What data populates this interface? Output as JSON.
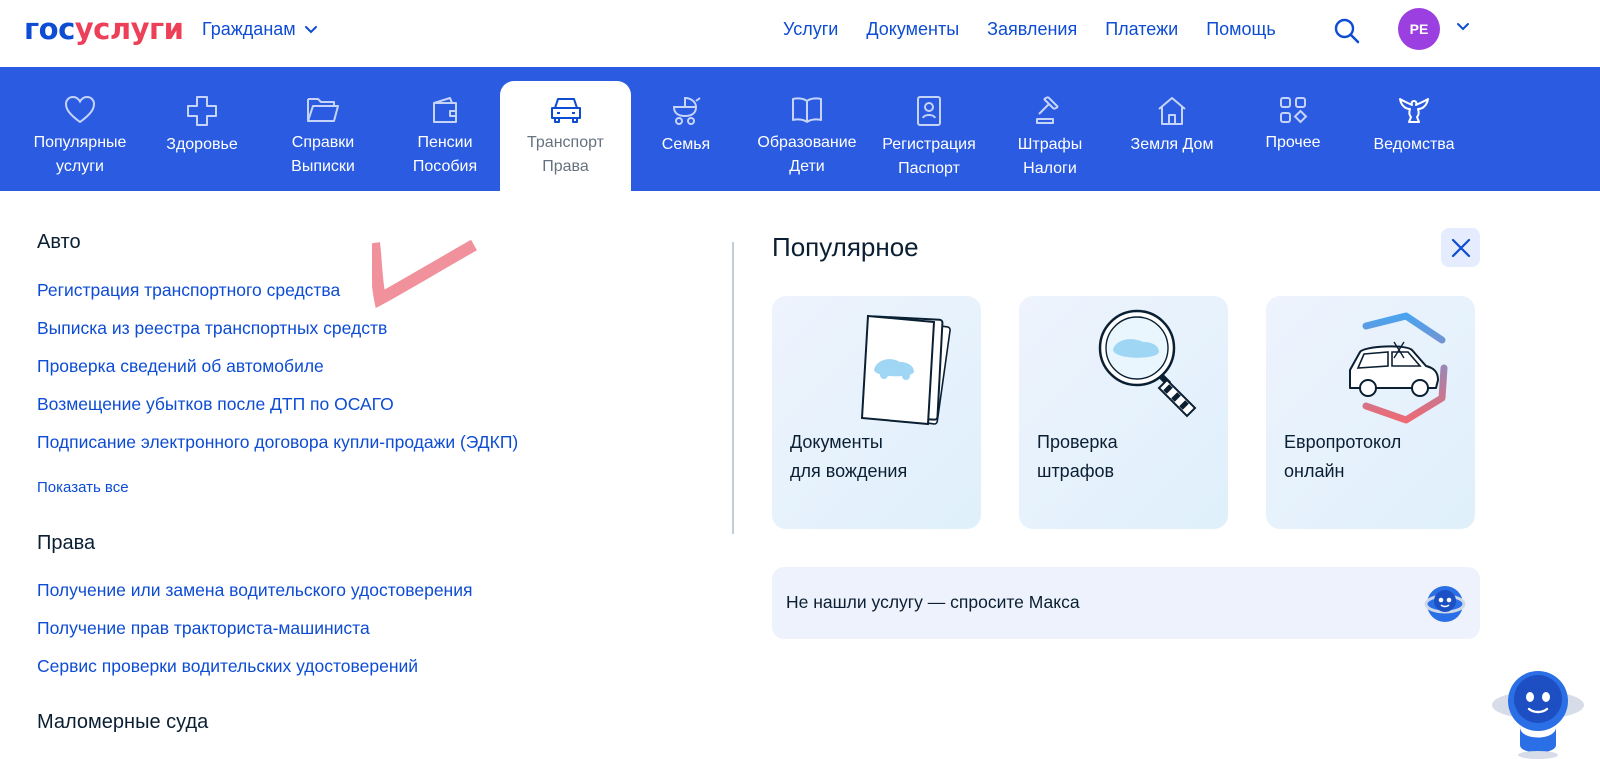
{
  "header": {
    "logo_part1": "гос",
    "logo_part2": "услуги",
    "audience": "Гражданам",
    "nav": [
      "Услуги",
      "Документы",
      "Заявления",
      "Платежи",
      "Помощь"
    ],
    "avatar_initials": "РЕ"
  },
  "categories": [
    {
      "line1": "Популярные",
      "line2": "услуги",
      "icon": "heart-icon"
    },
    {
      "line1": "Здоровье",
      "line2": "",
      "icon": "medical-cross-icon"
    },
    {
      "line1": "Справки",
      "line2": "Выписки",
      "icon": "folder-icon"
    },
    {
      "line1": "Пенсии",
      "line2": "Пособия",
      "icon": "wallet-icon"
    },
    {
      "line1": "Транспорт",
      "line2": "Права",
      "icon": "car-icon",
      "active": true
    },
    {
      "line1": "Семья",
      "line2": "",
      "icon": "stroller-icon"
    },
    {
      "line1": "Образование",
      "line2": "Дети",
      "icon": "book-icon"
    },
    {
      "line1": "Регистрация",
      "line2": "Паспорт",
      "icon": "passport-icon"
    },
    {
      "line1": "Штрафы",
      "line2": "Налоги",
      "icon": "gavel-icon"
    },
    {
      "line1": "Земля Дом",
      "line2": "",
      "icon": "house-icon"
    },
    {
      "line1": "Прочее",
      "line2": "",
      "icon": "grid-icon"
    },
    {
      "line1": "Ведомства",
      "line2": "",
      "icon": "eagle-icon"
    }
  ],
  "sections": {
    "auto": {
      "title": "Авто",
      "links": [
        "Регистрация транспортного средства",
        "Выписка из реестра транспортных средств",
        "Проверка сведений об автомобиле",
        "Возмещение убытков после ДТП по ОСАГО",
        "Подписание электронного договора купли-продажи (ЭДКП)"
      ],
      "show_all": "Показать все"
    },
    "rights": {
      "title": "Права",
      "links": [
        "Получение или замена водительского удостоверения",
        "Получение прав тракториста-машиниста",
        "Сервис проверки водительских удостоверений"
      ]
    },
    "boats": {
      "title": "Маломерные суда"
    }
  },
  "popular": {
    "title": "Популярное",
    "cards": [
      {
        "line1": "Документы",
        "line2": "для вождения",
        "icon": "documents-icon"
      },
      {
        "line1": "Проверка",
        "line2": "штрафов",
        "icon": "magnifier-icon"
      },
      {
        "line1": "Европротокол",
        "line2": "онлайн",
        "icon": "car-outline-icon"
      }
    ],
    "ask": "Не нашли услугу — спросите Макса"
  },
  "colors": {
    "brand_blue": "#0d4cd3",
    "brand_red": "#ee3f58",
    "category_bar": "#2a5be0",
    "avatar": "#9c3fe0"
  }
}
